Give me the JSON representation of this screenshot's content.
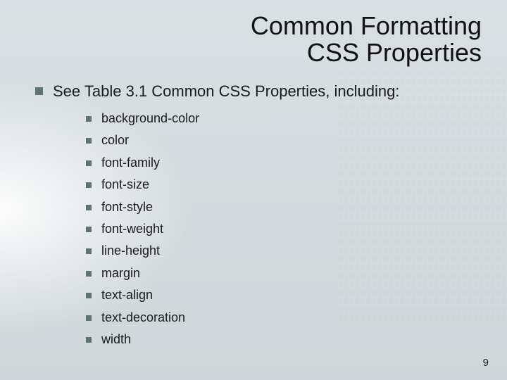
{
  "title_line1": "Common Formatting",
  "title_line2": "CSS Properties",
  "main_bullet": "See Table 3.1 Common CSS Properties, including:",
  "properties": [
    "background-color",
    "color",
    "font-family",
    "font-size",
    "font-style",
    "font-weight",
    "line-height",
    "margin",
    "text-align",
    "text-decoration",
    "width"
  ],
  "page_number": "9"
}
